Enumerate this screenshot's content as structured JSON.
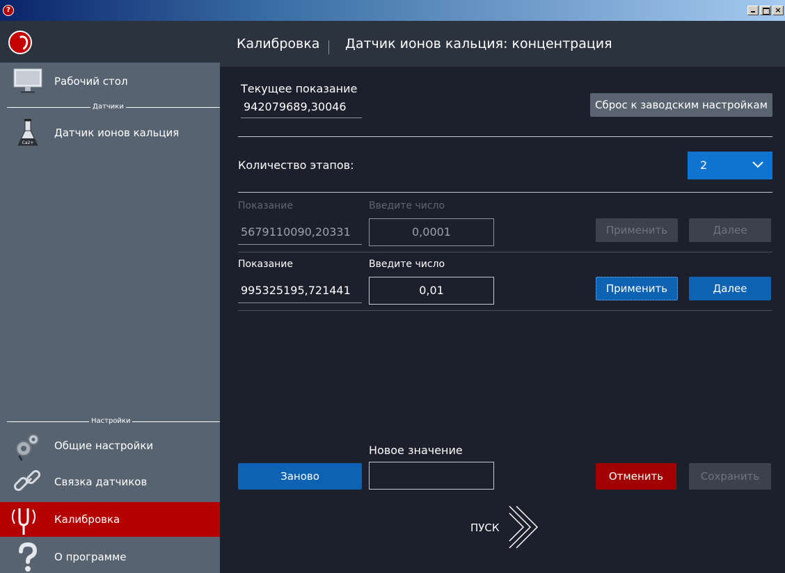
{
  "window": {
    "close_glyph": "×"
  },
  "sidebar": {
    "items": [
      {
        "label": "Рабочий стол",
        "icon": "monitor-icon"
      },
      {
        "label": "Датчик ионов кальция",
        "icon": "flask-icon"
      },
      {
        "label": "Общие настройки",
        "icon": "gears-icon"
      },
      {
        "label": "Связка датчиков",
        "icon": "link-icon"
      },
      {
        "label": "Калибровка",
        "icon": "tuning-fork-icon"
      },
      {
        "label": "О программе",
        "icon": "question-icon"
      }
    ],
    "sections": {
      "sensors": "Датчики",
      "settings": "Настройки"
    },
    "flask_badge": "Ca2+"
  },
  "header": {
    "breadcrumb": "Калибровка",
    "title": "Датчик ионов кальция: концентрация"
  },
  "current": {
    "label": "Текущее показание",
    "value": "942079689,30046",
    "reset_button": "Сброс к заводским настройкам"
  },
  "stages": {
    "label": "Количество этапов:",
    "selected": "2"
  },
  "rows": [
    {
      "reading_label": "Показание",
      "input_label": "Введите число",
      "reading": "5679110090,20331",
      "input": "0,0001",
      "apply": "Применить",
      "next": "Далее"
    },
    {
      "reading_label": "Показание",
      "input_label": "Введите число",
      "reading": "995325195,721441",
      "input": "0,01",
      "apply": "Применить",
      "next": "Далее"
    }
  ],
  "footer": {
    "restart": "Заново",
    "new_value_label": "Новое значение",
    "new_value": "",
    "cancel": "Отменить",
    "save": "Сохранить",
    "start": "ПУСК"
  },
  "colors": {
    "sidebar_bg": "#586371",
    "main_bg": "#1c202c",
    "header_bg": "#2a333e",
    "accent_blue": "#0e62b4",
    "accent_red": "#b50000"
  }
}
